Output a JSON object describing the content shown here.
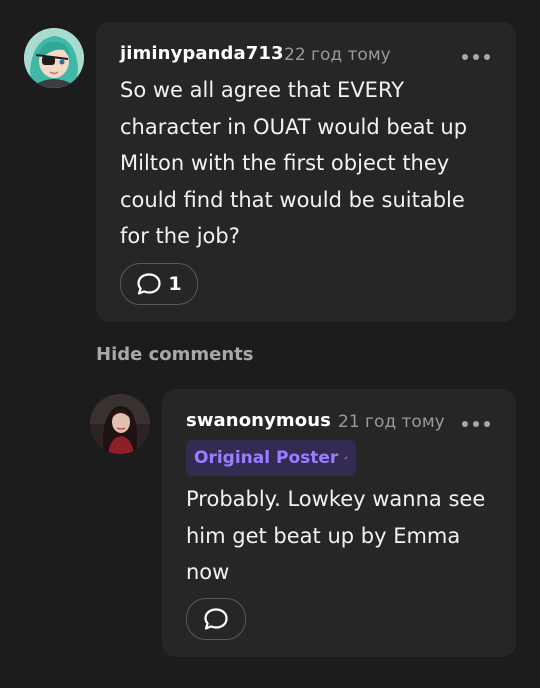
{
  "comments": [
    {
      "username": "jiminypanda713",
      "timestamp": "22 год тому",
      "text": "So we all agree that EVERY character in OUAT would beat up Milton with the first object they could find that would be suitable for the job?",
      "reply_count": "1",
      "avatar_icon": "anime-girl-avatar",
      "more_icon": "more-options-icon"
    }
  ],
  "thread": {
    "hide_comments_label": "Hide comments"
  },
  "replies": [
    {
      "username": "swanonymous",
      "timestamp": "21 год тому",
      "badge": "Original Poster",
      "badge_icon": "pencil-icon",
      "text": "Probably. Lowkey wanna see him get beat up by Emma now",
      "avatar_icon": "woman-portrait-avatar",
      "more_icon": "more-options-icon"
    }
  ],
  "colors": {
    "background": "#1c1c1c",
    "card": "#262626",
    "muted_text": "#9a9a9a",
    "badge_bg": "#332b52",
    "badge_text": "#9d7dff"
  }
}
